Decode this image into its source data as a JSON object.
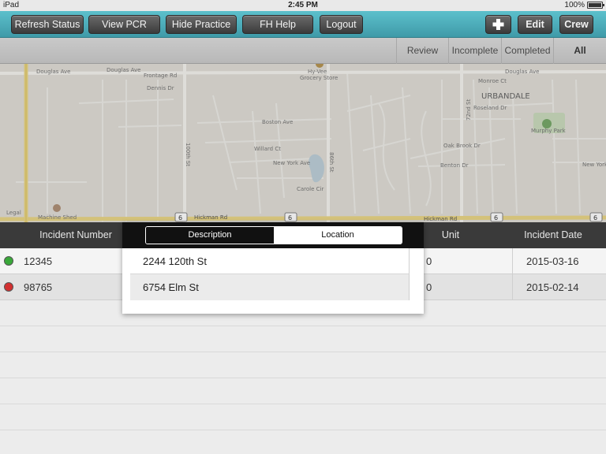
{
  "status_bar": {
    "device": "iPad",
    "time": "2:45 PM",
    "battery": "100%"
  },
  "toolbar": {
    "refresh_status": "Refresh Status",
    "view_pcr": "View PCR",
    "hide_practice": "Hide Practice",
    "fh_help": "FH Help",
    "logout": "Logout",
    "add_icon": "plus-icon",
    "edit": "Edit",
    "crew": "Crew"
  },
  "filters": [
    "Review",
    "Incomplete",
    "Completed",
    "All"
  ],
  "filters_active": "All",
  "map": {
    "labels": {
      "douglas_ave_1": "Douglas Ave",
      "douglas_ave_2": "Douglas Ave",
      "douglas_ave_3": "Douglas Ave",
      "frontage_rd": "Frontage Rd",
      "dennis_dr": "Dennis Dr",
      "hy_vee": "Hy-Vee",
      "grocery_store": "Grocery Store",
      "monroe_ct": "Monroe Ct",
      "urbandale": "URBANDALE",
      "roseland_dr": "Roseland Dr",
      "boston_ave": "Boston Ave",
      "willard_ct": "Willard Ct",
      "new_york_ave_1": "New York Ave",
      "new_york_ave_2": "New York Ave",
      "carole_cir": "Carole Cir",
      "oak_brook_dr": "Oak Brook Dr",
      "benton_dr": "Benton Dr",
      "murphy_park": "Murphy Park",
      "hickman_rd_1": "Hickman Rd",
      "hickman_rd_2": "Hickman Rd",
      "machine_shed": "Machine Shed",
      "legal": "Legal",
      "st_100th": "100th St",
      "st_86th": "86th St",
      "st_72nd": "72nd St",
      "route": "6"
    }
  },
  "table": {
    "headers": {
      "incident_number": "Incident Number",
      "unit": "Unit",
      "incident_date": "Incident Date"
    },
    "rows": [
      {
        "status_color": "#3aa83a",
        "incident_number": "12345",
        "unit": "0",
        "incident_date": "2015-03-16"
      },
      {
        "status_color": "#d23030",
        "incident_number": "98765",
        "unit": "0",
        "incident_date": "2015-02-14"
      }
    ]
  },
  "popover": {
    "segments": {
      "description": "Description",
      "location": "Location"
    },
    "selected": "Description",
    "rows": [
      "2244 120th St",
      "6754 Elm St"
    ]
  },
  "colors": {
    "toolbar": "#4aaab6",
    "header": "#3a3a3a",
    "status_green": "#3aa83a",
    "status_red": "#d23030"
  }
}
